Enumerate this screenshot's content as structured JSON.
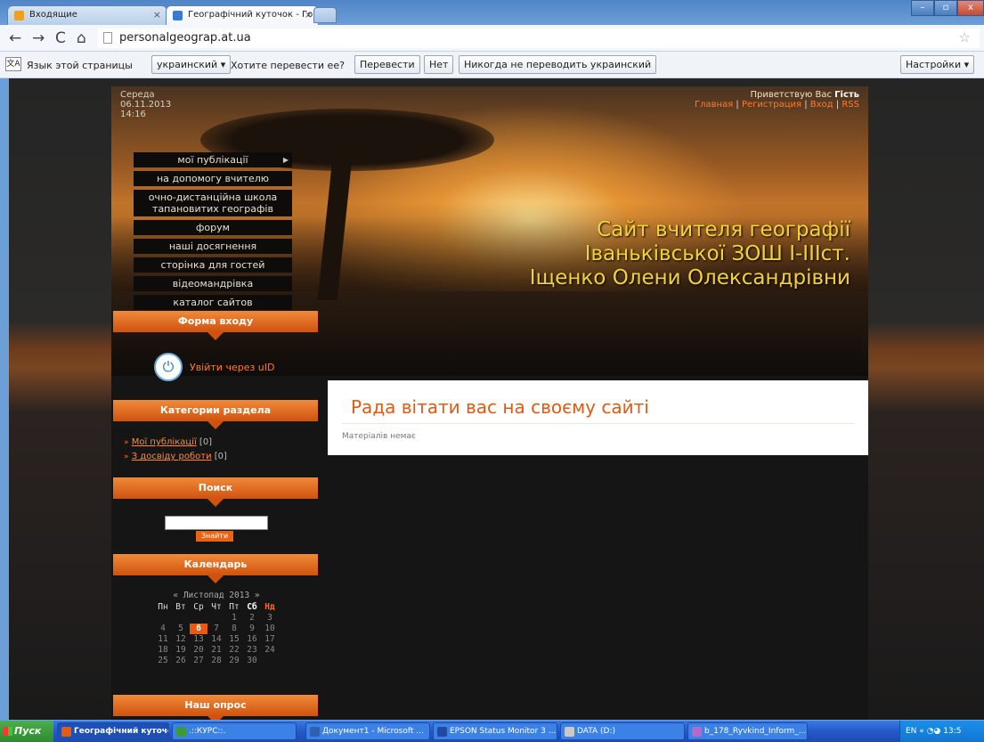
{
  "browser": {
    "tabs": [
      {
        "label": "Входящие"
      },
      {
        "label": "Географічний куточок - Го"
      }
    ],
    "url": "personalgeograp.at.ua",
    "translate_bar": {
      "label_lang": "Язык этой страницы",
      "lang_value": "украинский ▾",
      "question": "Хотите перевести ее?",
      "translate_btn": "Перевести",
      "no_btn": "Нет",
      "never_btn": "Никогда не переводить украинский",
      "settings_btn": "Настройки ▾"
    }
  },
  "site": {
    "date": {
      "weekday": "Середа",
      "date": "06.11.2013",
      "time": "14:16"
    },
    "greeting": {
      "prefix": "Приветствую Вас",
      "user": "Гість",
      "links": [
        "Главная",
        "Регистрация",
        "Вход",
        "RSS"
      ]
    },
    "menu": [
      "мої публікації",
      "на допомогу вчителю",
      "очно-дистанційна школа тапановитих географів",
      "форум",
      "наші досягнення",
      "сторінка для гостей",
      "відеомандрівка",
      "каталог сайтов"
    ],
    "title_lines": [
      "Сайт вчителя географії",
      "Іваньківської ЗОШ І-ІІІст.",
      "Іщенко Олени Олександрівни"
    ],
    "blocks": {
      "login": {
        "title": "Форма входу",
        "link": "Увійти через uID"
      },
      "categories": {
        "title": "Категории раздела",
        "items": [
          {
            "label": "Мої публікації",
            "count": "[0]"
          },
          {
            "label": "З досвіду роботи",
            "count": "[0]"
          }
        ]
      },
      "search": {
        "title": "Поиск",
        "button": "Знайти"
      },
      "calendar": {
        "title": "Календарь",
        "month": "« Листопад 2013 »",
        "weekdays": [
          "Пн",
          "Вт",
          "Ср",
          "Чт",
          "Пт",
          "Сб",
          "Нд"
        ],
        "weeks": [
          [
            "",
            "",
            "",
            "",
            "1",
            "2",
            "3"
          ],
          [
            "4",
            "5",
            "6",
            "7",
            "8",
            "9",
            "10"
          ],
          [
            "11",
            "12",
            "13",
            "14",
            "15",
            "16",
            "17"
          ],
          [
            "18",
            "19",
            "20",
            "21",
            "22",
            "23",
            "24"
          ],
          [
            "25",
            "26",
            "27",
            "28",
            "29",
            "30",
            ""
          ]
        ],
        "today": "6"
      },
      "poll": {
        "title": "Наш опрос"
      }
    },
    "content": {
      "heading": "Рада вітати вас на своєму сайті",
      "empty_text": "Матеріалів немає"
    }
  },
  "taskbar": {
    "start": "Пуск",
    "tasks": [
      "Географічний куточо...",
      ".::КУРС::.",
      "Документ1 - Microsoft ...",
      "EPSON Status Monitor 3 ...",
      "DATA (D:)",
      "b_178_Ryvkind_Inform_..."
    ],
    "lang": "EN",
    "clock": "13:5"
  },
  "colors": {
    "accent_orange": "#e85a12",
    "title_yellow": "#f2d23a",
    "link_orange": "#ff7a2a"
  }
}
